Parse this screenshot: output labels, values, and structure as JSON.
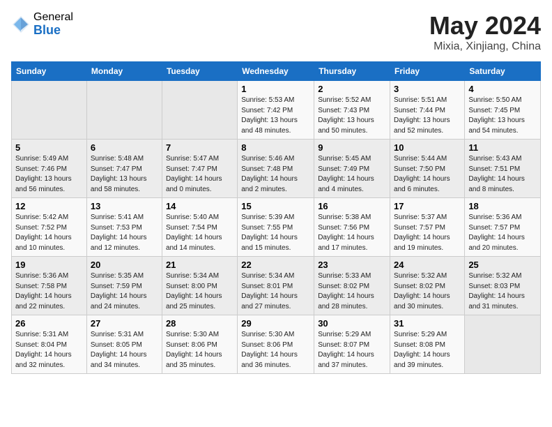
{
  "logo": {
    "general": "General",
    "blue": "Blue"
  },
  "title": "May 2024",
  "subtitle": "Mixia, Xinjiang, China",
  "days_header": [
    "Sunday",
    "Monday",
    "Tuesday",
    "Wednesday",
    "Thursday",
    "Friday",
    "Saturday"
  ],
  "weeks": [
    [
      {
        "num": "",
        "info": ""
      },
      {
        "num": "",
        "info": ""
      },
      {
        "num": "",
        "info": ""
      },
      {
        "num": "1",
        "info": "Sunrise: 5:53 AM\nSunset: 7:42 PM\nDaylight: 13 hours\nand 48 minutes."
      },
      {
        "num": "2",
        "info": "Sunrise: 5:52 AM\nSunset: 7:43 PM\nDaylight: 13 hours\nand 50 minutes."
      },
      {
        "num": "3",
        "info": "Sunrise: 5:51 AM\nSunset: 7:44 PM\nDaylight: 13 hours\nand 52 minutes."
      },
      {
        "num": "4",
        "info": "Sunrise: 5:50 AM\nSunset: 7:45 PM\nDaylight: 13 hours\nand 54 minutes."
      }
    ],
    [
      {
        "num": "5",
        "info": "Sunrise: 5:49 AM\nSunset: 7:46 PM\nDaylight: 13 hours\nand 56 minutes."
      },
      {
        "num": "6",
        "info": "Sunrise: 5:48 AM\nSunset: 7:47 PM\nDaylight: 13 hours\nand 58 minutes."
      },
      {
        "num": "7",
        "info": "Sunrise: 5:47 AM\nSunset: 7:47 PM\nDaylight: 14 hours\nand 0 minutes."
      },
      {
        "num": "8",
        "info": "Sunrise: 5:46 AM\nSunset: 7:48 PM\nDaylight: 14 hours\nand 2 minutes."
      },
      {
        "num": "9",
        "info": "Sunrise: 5:45 AM\nSunset: 7:49 PM\nDaylight: 14 hours\nand 4 minutes."
      },
      {
        "num": "10",
        "info": "Sunrise: 5:44 AM\nSunset: 7:50 PM\nDaylight: 14 hours\nand 6 minutes."
      },
      {
        "num": "11",
        "info": "Sunrise: 5:43 AM\nSunset: 7:51 PM\nDaylight: 14 hours\nand 8 minutes."
      }
    ],
    [
      {
        "num": "12",
        "info": "Sunrise: 5:42 AM\nSunset: 7:52 PM\nDaylight: 14 hours\nand 10 minutes."
      },
      {
        "num": "13",
        "info": "Sunrise: 5:41 AM\nSunset: 7:53 PM\nDaylight: 14 hours\nand 12 minutes."
      },
      {
        "num": "14",
        "info": "Sunrise: 5:40 AM\nSunset: 7:54 PM\nDaylight: 14 hours\nand 14 minutes."
      },
      {
        "num": "15",
        "info": "Sunrise: 5:39 AM\nSunset: 7:55 PM\nDaylight: 14 hours\nand 15 minutes."
      },
      {
        "num": "16",
        "info": "Sunrise: 5:38 AM\nSunset: 7:56 PM\nDaylight: 14 hours\nand 17 minutes."
      },
      {
        "num": "17",
        "info": "Sunrise: 5:37 AM\nSunset: 7:57 PM\nDaylight: 14 hours\nand 19 minutes."
      },
      {
        "num": "18",
        "info": "Sunrise: 5:36 AM\nSunset: 7:57 PM\nDaylight: 14 hours\nand 20 minutes."
      }
    ],
    [
      {
        "num": "19",
        "info": "Sunrise: 5:36 AM\nSunset: 7:58 PM\nDaylight: 14 hours\nand 22 minutes."
      },
      {
        "num": "20",
        "info": "Sunrise: 5:35 AM\nSunset: 7:59 PM\nDaylight: 14 hours\nand 24 minutes."
      },
      {
        "num": "21",
        "info": "Sunrise: 5:34 AM\nSunset: 8:00 PM\nDaylight: 14 hours\nand 25 minutes."
      },
      {
        "num": "22",
        "info": "Sunrise: 5:34 AM\nSunset: 8:01 PM\nDaylight: 14 hours\nand 27 minutes."
      },
      {
        "num": "23",
        "info": "Sunrise: 5:33 AM\nSunset: 8:02 PM\nDaylight: 14 hours\nand 28 minutes."
      },
      {
        "num": "24",
        "info": "Sunrise: 5:32 AM\nSunset: 8:02 PM\nDaylight: 14 hours\nand 30 minutes."
      },
      {
        "num": "25",
        "info": "Sunrise: 5:32 AM\nSunset: 8:03 PM\nDaylight: 14 hours\nand 31 minutes."
      }
    ],
    [
      {
        "num": "26",
        "info": "Sunrise: 5:31 AM\nSunset: 8:04 PM\nDaylight: 14 hours\nand 32 minutes."
      },
      {
        "num": "27",
        "info": "Sunrise: 5:31 AM\nSunset: 8:05 PM\nDaylight: 14 hours\nand 34 minutes."
      },
      {
        "num": "28",
        "info": "Sunrise: 5:30 AM\nSunset: 8:06 PM\nDaylight: 14 hours\nand 35 minutes."
      },
      {
        "num": "29",
        "info": "Sunrise: 5:30 AM\nSunset: 8:06 PM\nDaylight: 14 hours\nand 36 minutes."
      },
      {
        "num": "30",
        "info": "Sunrise: 5:29 AM\nSunset: 8:07 PM\nDaylight: 14 hours\nand 37 minutes."
      },
      {
        "num": "31",
        "info": "Sunrise: 5:29 AM\nSunset: 8:08 PM\nDaylight: 14 hours\nand 39 minutes."
      },
      {
        "num": "",
        "info": ""
      }
    ]
  ]
}
